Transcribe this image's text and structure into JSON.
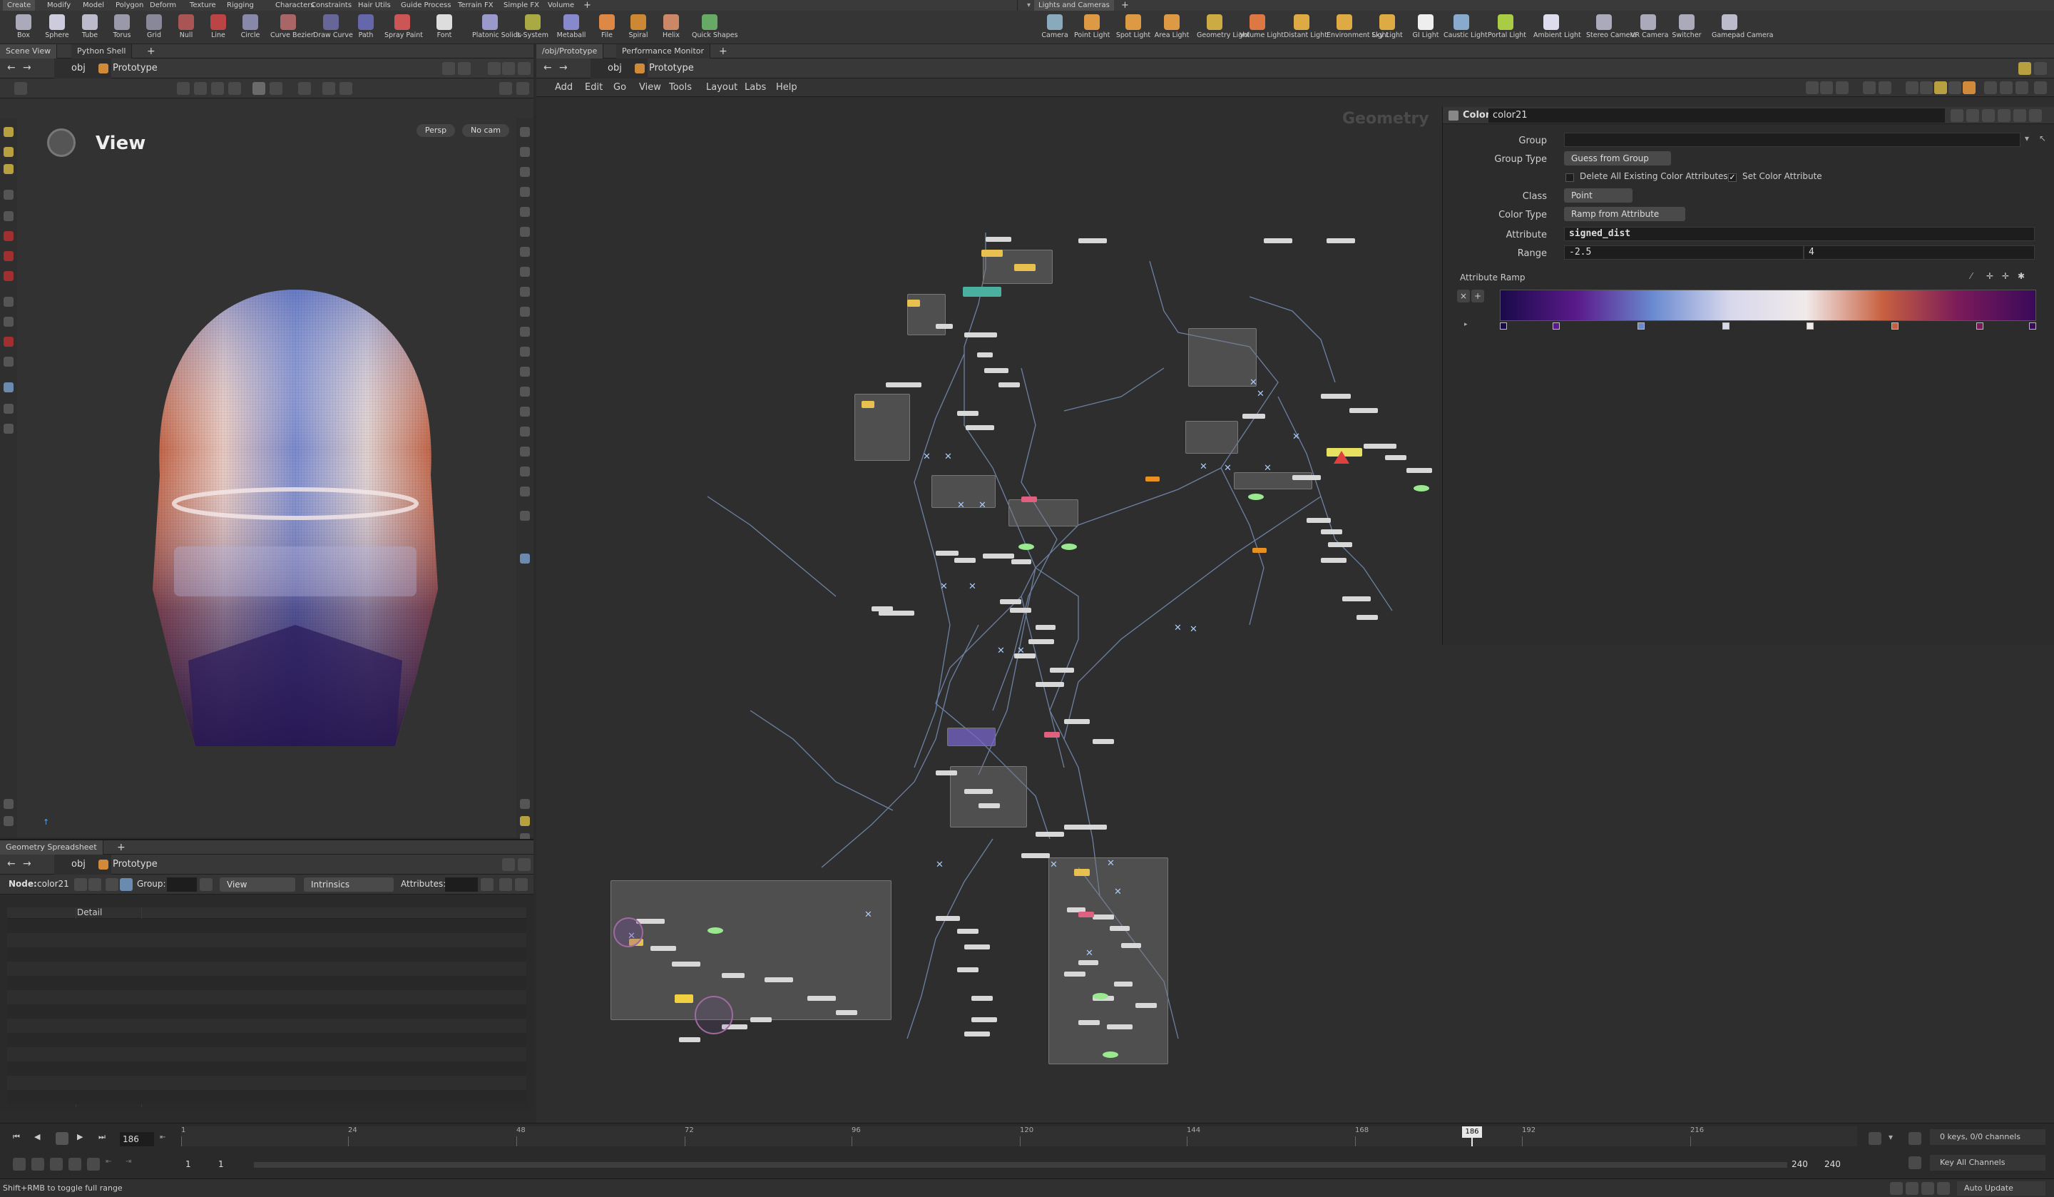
{
  "shelf_tabs_left": [
    "Create",
    "Modify",
    "Model",
    "Polygon",
    "Deform",
    "Texture",
    "Rigging",
    "Characters",
    "Constraints",
    "Hair Utils",
    "Guide Process",
    "Terrain FX",
    "Simple FX",
    "Volume"
  ],
  "shelf_tabs_right": [
    "Lights and Cameras"
  ],
  "create_tools": [
    "Box",
    "Sphere",
    "Tube",
    "Torus",
    "Grid",
    "Null",
    "Line",
    "Circle",
    "Curve Bezier",
    "Draw Curve",
    "Path",
    "Spray Paint",
    "Font",
    "Platonic Solids",
    "L-System",
    "Metaball",
    "File",
    "Spiral",
    "Helix",
    "Quick Shapes"
  ],
  "light_tools": [
    "Camera",
    "Point Light",
    "Spot Light",
    "Area Light",
    "Geometry Light",
    "Volume Light",
    "Distant Light",
    "Environment Light",
    "Sky Light",
    "GI Light",
    "Caustic Light",
    "Portal Light",
    "Ambient Light",
    "Stereo Camera",
    "VR Camera",
    "Switcher",
    "Gamepad Camera"
  ],
  "viewer": {
    "tabs": [
      "Scene View",
      "Python Shell"
    ],
    "path_obj": "obj",
    "path_node": "Prototype",
    "title": "View",
    "persp": "Persp",
    "cam": "No cam"
  },
  "network": {
    "tabs": [
      "/obj/Prototype",
      "Performance Monitor"
    ],
    "path_obj": "obj",
    "path_node": "Prototype",
    "menu": [
      "Add",
      "Edit",
      "Go",
      "View",
      "Tools",
      "Layout",
      "Labs",
      "Help"
    ],
    "context_label": "Geometry"
  },
  "params": {
    "node_type": "Color",
    "node_name": "color21",
    "group_label": "Group",
    "group_value": "",
    "group_type_label": "Group Type",
    "group_type_value": "Guess from Group",
    "delete_label": "Delete All Existing Color Attributes",
    "set_color_label": "Set Color Attribute",
    "class_label": "Class",
    "class_value": "Point",
    "color_type_label": "Color Type",
    "color_type_value": "Ramp from Attribute",
    "attribute_label": "Attribute",
    "attribute_value": "signed_dist",
    "range_label": "Range",
    "range_min": "-2.5",
    "range_max": "4",
    "ramp_label": "Attribute Ramp",
    "ramp_colors": [
      "#1a0a4a",
      "#5a1a8a",
      "#6a8ad0",
      "#d8d8ec",
      "#f0eaea",
      "#c86040",
      "#7a1a5a",
      "#3a0a5a"
    ]
  },
  "spreadsheet": {
    "tabs": [
      "Geometry Spreadsheet"
    ],
    "path_obj": "obj",
    "path_node": "Prototype",
    "node_label": "Node:",
    "node_value": "color21",
    "group_label": "Group:",
    "view_value": "View",
    "intrinsics_value": "Intrinsics",
    "attributes_label": "Attributes:",
    "column_header": "Detail"
  },
  "timeline": {
    "current_frame": "186",
    "ticks": [
      "1",
      "24",
      "48",
      "72",
      "96",
      "120",
      "144",
      "168",
      "192",
      "216"
    ],
    "marker": "186",
    "range_start": "1",
    "range_start2": "1",
    "range_end": "240",
    "range_end2": "240",
    "keys_info": "0 keys, 0/0 channels",
    "key_all": "Key All Channels",
    "auto_update": "Auto Update"
  },
  "status_text": "Shift+RMB to toggle full range"
}
